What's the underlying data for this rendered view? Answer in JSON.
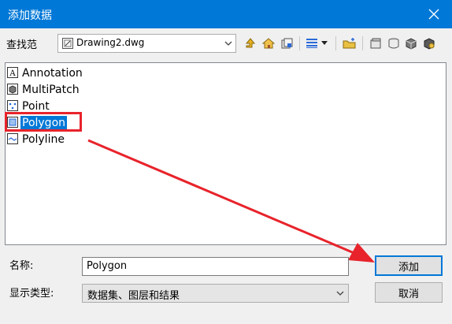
{
  "dialog": {
    "title": "添加数据",
    "close_icon": "close-icon"
  },
  "look_in": {
    "label": "查找范",
    "value": "Drawing2.dwg",
    "icon": "cad-drawing-icon"
  },
  "toolbar": {
    "icons": [
      "up-one-level-icon",
      "home-icon",
      "connect-folder-icon",
      "list-view-icon",
      "view-options-dropdown-icon",
      "new-folder-icon",
      "new-geodatabase-icon",
      "new-database-icon",
      "database-connection-icon",
      "new-server-connection-icon"
    ]
  },
  "list": {
    "items": [
      {
        "label": "Annotation",
        "icon": "annotation-class-icon",
        "selected": false
      },
      {
        "label": "MultiPatch",
        "icon": "multipatch-class-icon",
        "selected": false
      },
      {
        "label": "Point",
        "icon": "point-class-icon",
        "selected": false
      },
      {
        "label": "Polygon",
        "icon": "polygon-class-icon",
        "selected": true
      },
      {
        "label": "Polyline",
        "icon": "polyline-class-icon",
        "selected": false
      }
    ]
  },
  "name_field": {
    "label": "名称:",
    "value": "Polygon"
  },
  "type_field": {
    "label": "显示类型:",
    "value": "数据集、图层和结果"
  },
  "buttons": {
    "add": "添加",
    "cancel": "取消"
  },
  "colors": {
    "title_bar": "#0078d7",
    "selection": "#0078d7",
    "annotation_red": "#e8232b"
  }
}
